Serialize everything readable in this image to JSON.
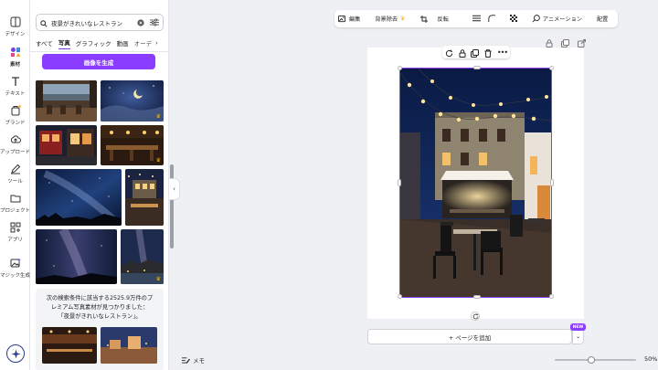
{
  "rail": {
    "items": [
      {
        "label": "デザイン",
        "icon": "layout-icon"
      },
      {
        "label": "素材",
        "icon": "elements-icon"
      },
      {
        "label": "テキスト",
        "icon": "text-icon"
      },
      {
        "label": "ブランド",
        "icon": "brand-icon"
      },
      {
        "label": "アップロード",
        "icon": "upload-icon"
      },
      {
        "label": "ツール",
        "icon": "draw-icon"
      },
      {
        "label": "プロジェクト",
        "icon": "folder-icon"
      },
      {
        "label": "アプリ",
        "icon": "apps-icon"
      },
      {
        "label": "マジック生成",
        "icon": "magic-media-icon"
      }
    ]
  },
  "panel": {
    "search_value": "夜景がきれいなレストラン",
    "tabs": [
      "すべて",
      "写真",
      "グラフィック",
      "動画",
      "オーデ"
    ],
    "active_tab": "写真",
    "generate_button": "画像を生成",
    "info_message_1": "次の検索条件に該当する2525.9万件のプ",
    "info_message_2": "レミアム写真素材が見つかりました：",
    "info_message_3": "「夜景がきれいなレストラン」。"
  },
  "toolbar": {
    "edit": "編集",
    "remove_bg": "背景除去",
    "flip": "反転",
    "animate": "アニメーション",
    "position": "配置",
    "color_1": "#1f3a68",
    "color_2": "#e0b887"
  },
  "canvas": {
    "add_page": "+ ページを追加",
    "new_badge": "NEW"
  },
  "footer": {
    "notes": "メモ",
    "zoom_percent": 50,
    "zoom_label": "50%"
  },
  "colors": {
    "accent": "#8b3dff",
    "page_bg": "#eef0f3"
  }
}
